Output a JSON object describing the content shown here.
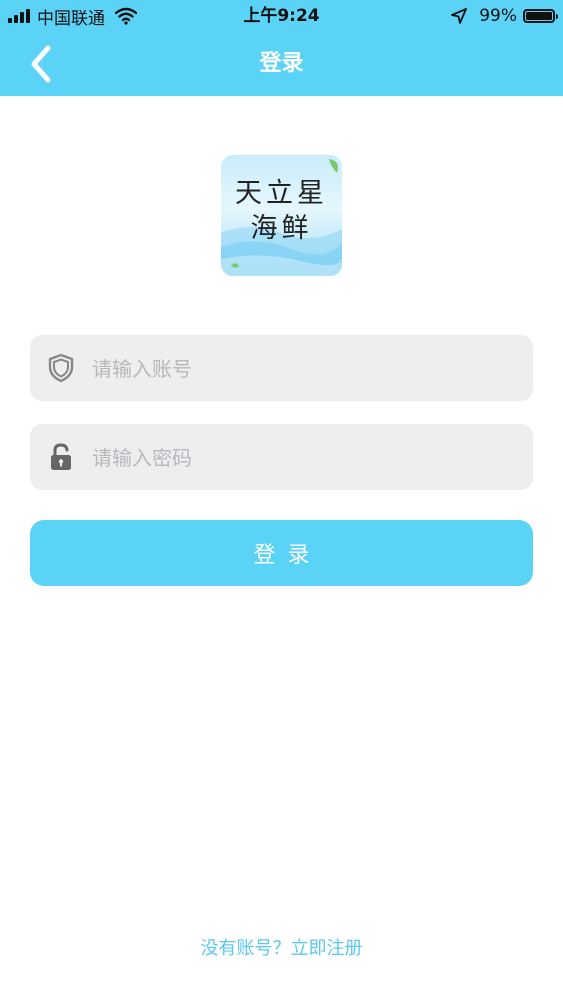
{
  "status_bar": {
    "carrier": "中国联通",
    "time": "上午9:24",
    "battery_text": "99%",
    "battery_level": 0.99,
    "icons": [
      "signal-icon",
      "wifi-icon",
      "location-arrow-icon",
      "battery-icon"
    ]
  },
  "nav": {
    "title": "登录",
    "back_icon": "chevron-left-icon"
  },
  "logo": {
    "line1": "天立星",
    "line2": "海鲜"
  },
  "form": {
    "account": {
      "placeholder": "请输入账号",
      "value": "",
      "icon": "shield-icon"
    },
    "password": {
      "placeholder": "请输入密码",
      "value": "",
      "icon": "unlock-icon"
    },
    "submit_label": "登录"
  },
  "footer": {
    "register_link": "没有账号？立即注册"
  },
  "colors": {
    "accent": "#5bd3f7",
    "input_bg": "#eeedf0",
    "placeholder": "#b8b8bc",
    "link": "#5bc8ef",
    "background": "#ffffff"
  }
}
